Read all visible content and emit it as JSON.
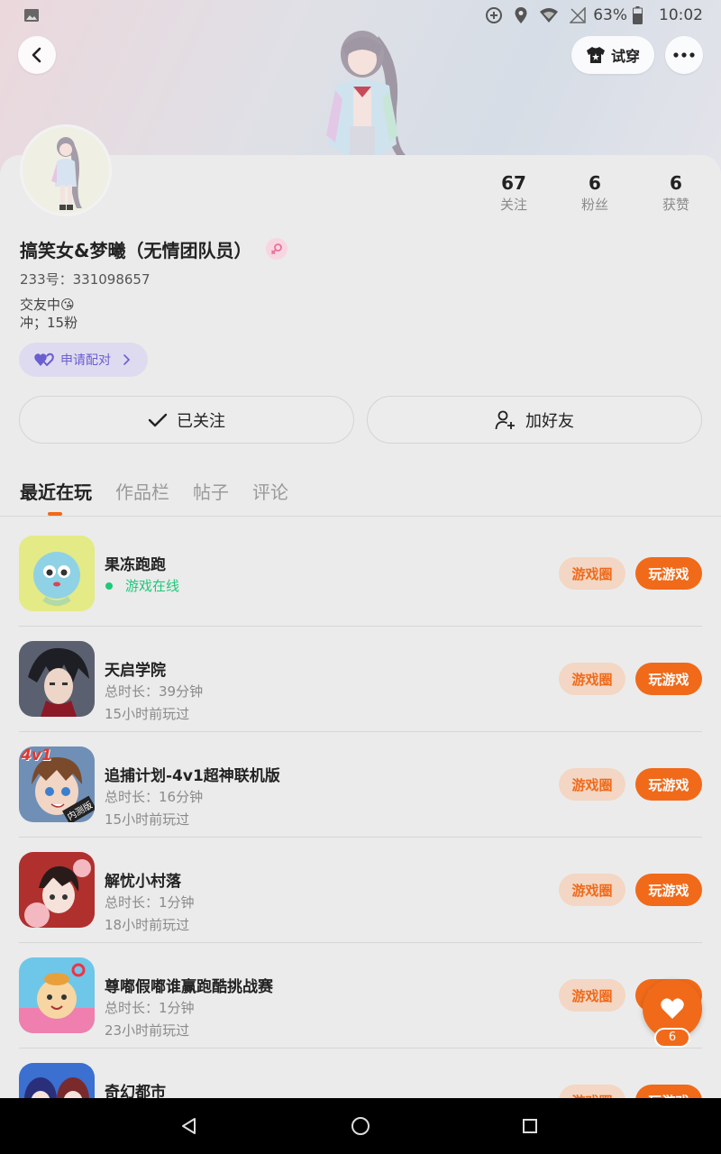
{
  "status_bar": {
    "battery": "63%",
    "time": "10:02"
  },
  "header": {
    "tryon_label": "试穿"
  },
  "profile": {
    "stats": [
      {
        "value": "67",
        "label": "关注"
      },
      {
        "value": "6",
        "label": "粉丝"
      },
      {
        "value": "6",
        "label": "获赞"
      }
    ],
    "nickname": "搞笑女&梦曦（无情团队员）",
    "uid": "233号：331098657",
    "bio_line1": "交友中😘",
    "bio_line2": "冲；15粉",
    "match_label": "申请配对",
    "follow_label": "已关注",
    "add_friend_label": "加好友"
  },
  "tabs": [
    "最近在玩",
    "作品栏",
    "帖子",
    "评论"
  ],
  "buttons": {
    "circle": "游戏圈",
    "play": "玩游戏"
  },
  "games": [
    {
      "name": "果冻跑跑",
      "status": "游戏在线"
    },
    {
      "name": "天启学院",
      "duration": "总时长：39分钟",
      "last_played": "15小时前玩过"
    },
    {
      "name": "追捕计划-4v1超神联机版",
      "duration": "总时长：16分钟",
      "last_played": "15小时前玩过",
      "icon_text": "4v1",
      "icon_badge": "内测版"
    },
    {
      "name": "解忧小村落",
      "duration": "总时长：1分钟",
      "last_played": "18小时前玩过"
    },
    {
      "name": "尊嘟假嘟谁赢跑酷挑战赛",
      "duration": "总时长：1分钟",
      "last_played": "23小时前玩过"
    },
    {
      "name": "奇幻都市"
    }
  ],
  "like": {
    "count": "6"
  },
  "colors": {
    "accent": "#f06a1a",
    "online": "#1ec97a",
    "match": "#6a5fd0"
  }
}
